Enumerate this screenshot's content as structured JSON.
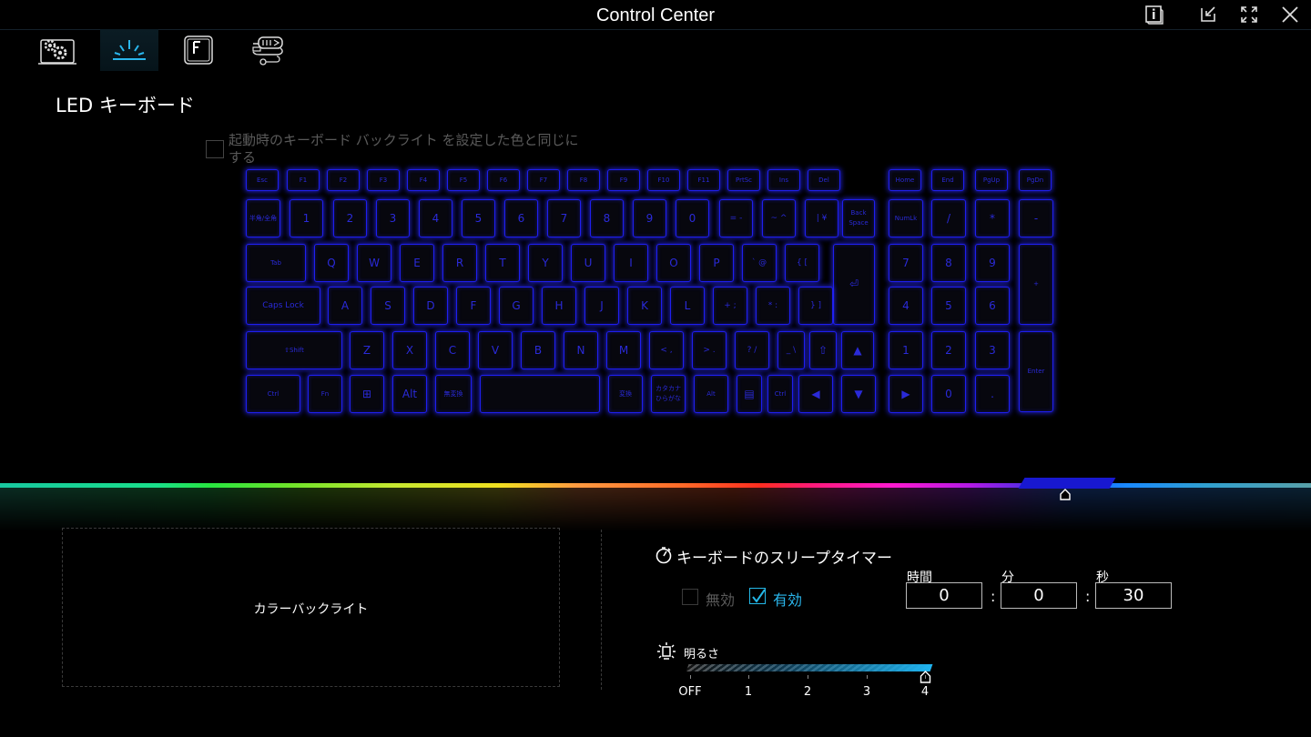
{
  "window": {
    "title": "Control Center",
    "buttons": [
      "info-icon",
      "restore-icon",
      "maximize-icon",
      "close-icon"
    ]
  },
  "tabs": [
    {
      "icon": "system-settings-icon",
      "active": false
    },
    {
      "icon": "led-keyboard-icon",
      "active": true
    },
    {
      "icon": "function-key-icon",
      "active": false
    },
    {
      "icon": "peripheral-cable-icon",
      "active": false
    }
  ],
  "page": {
    "title": "LED キーボード"
  },
  "startup_checkbox": {
    "label": "起動時のキーボード バックライト を設定した色と同じにする",
    "checked": false
  },
  "keyboard": {
    "fn_row": [
      "Esc",
      "F1",
      "F2",
      "F3",
      "F4",
      "F5",
      "F6",
      "F7",
      "F8",
      "F9",
      "F10",
      "F11",
      "PrtSc",
      "Ins",
      "Del",
      "Home",
      "End",
      "PgUp",
      "PgDn"
    ],
    "num_row": [
      "半角/全角",
      "1",
      "2",
      "3",
      "4",
      "5",
      "6",
      "7",
      "8",
      "9",
      "0",
      "= -",
      "~ ^",
      "| ¥",
      "Back Space",
      "NumLk",
      "/",
      "*",
      "-"
    ],
    "top_row": [
      "Tab",
      "Q",
      "W",
      "E",
      "R",
      "T",
      "Y",
      "U",
      "I",
      "O",
      "P",
      "` @",
      "{ [",
      "⏎",
      "7",
      "8",
      "9",
      "+"
    ],
    "home_row": [
      "Caps Lock",
      "A",
      "S",
      "D",
      "F",
      "G",
      "H",
      "J",
      "K",
      "L",
      "+ ;",
      "* :",
      "} ]",
      "4",
      "5",
      "6"
    ],
    "bottom_row": [
      "⇧Shift",
      "Z",
      "X",
      "C",
      "V",
      "B",
      "N",
      "M",
      "< ,",
      "> .",
      "? /",
      "_ \\",
      "⇧",
      "▲",
      "1",
      "2",
      "3",
      "Enter"
    ],
    "space_row": [
      "Ctrl",
      "Fn",
      "⊞",
      "Alt",
      "無変換",
      "",
      "変換",
      "カタカナ ひらがな",
      "Alt",
      "▤",
      "Ctrl",
      "◀",
      "▼",
      "▶",
      "0",
      "."
    ]
  },
  "hue_bar": {
    "selected_color": "#1818d0"
  },
  "color_panel": {
    "label": "カラーバックライト"
  },
  "sleep_timer": {
    "title": "キーボードのスリープタイマー",
    "disable_label": "無効",
    "enable_label": "有効",
    "enabled": true,
    "hours_label": "時間",
    "minutes_label": "分",
    "seconds_label": "秒",
    "hours": "0",
    "minutes": "0",
    "seconds": "30",
    "separator": ":"
  },
  "brightness": {
    "label": "明るさ",
    "ticks": [
      "OFF",
      "1",
      "2",
      "3",
      "4"
    ],
    "value": 4
  },
  "colors": {
    "accent": "#1fb4f0",
    "key_glow": "#1e1ef0"
  }
}
